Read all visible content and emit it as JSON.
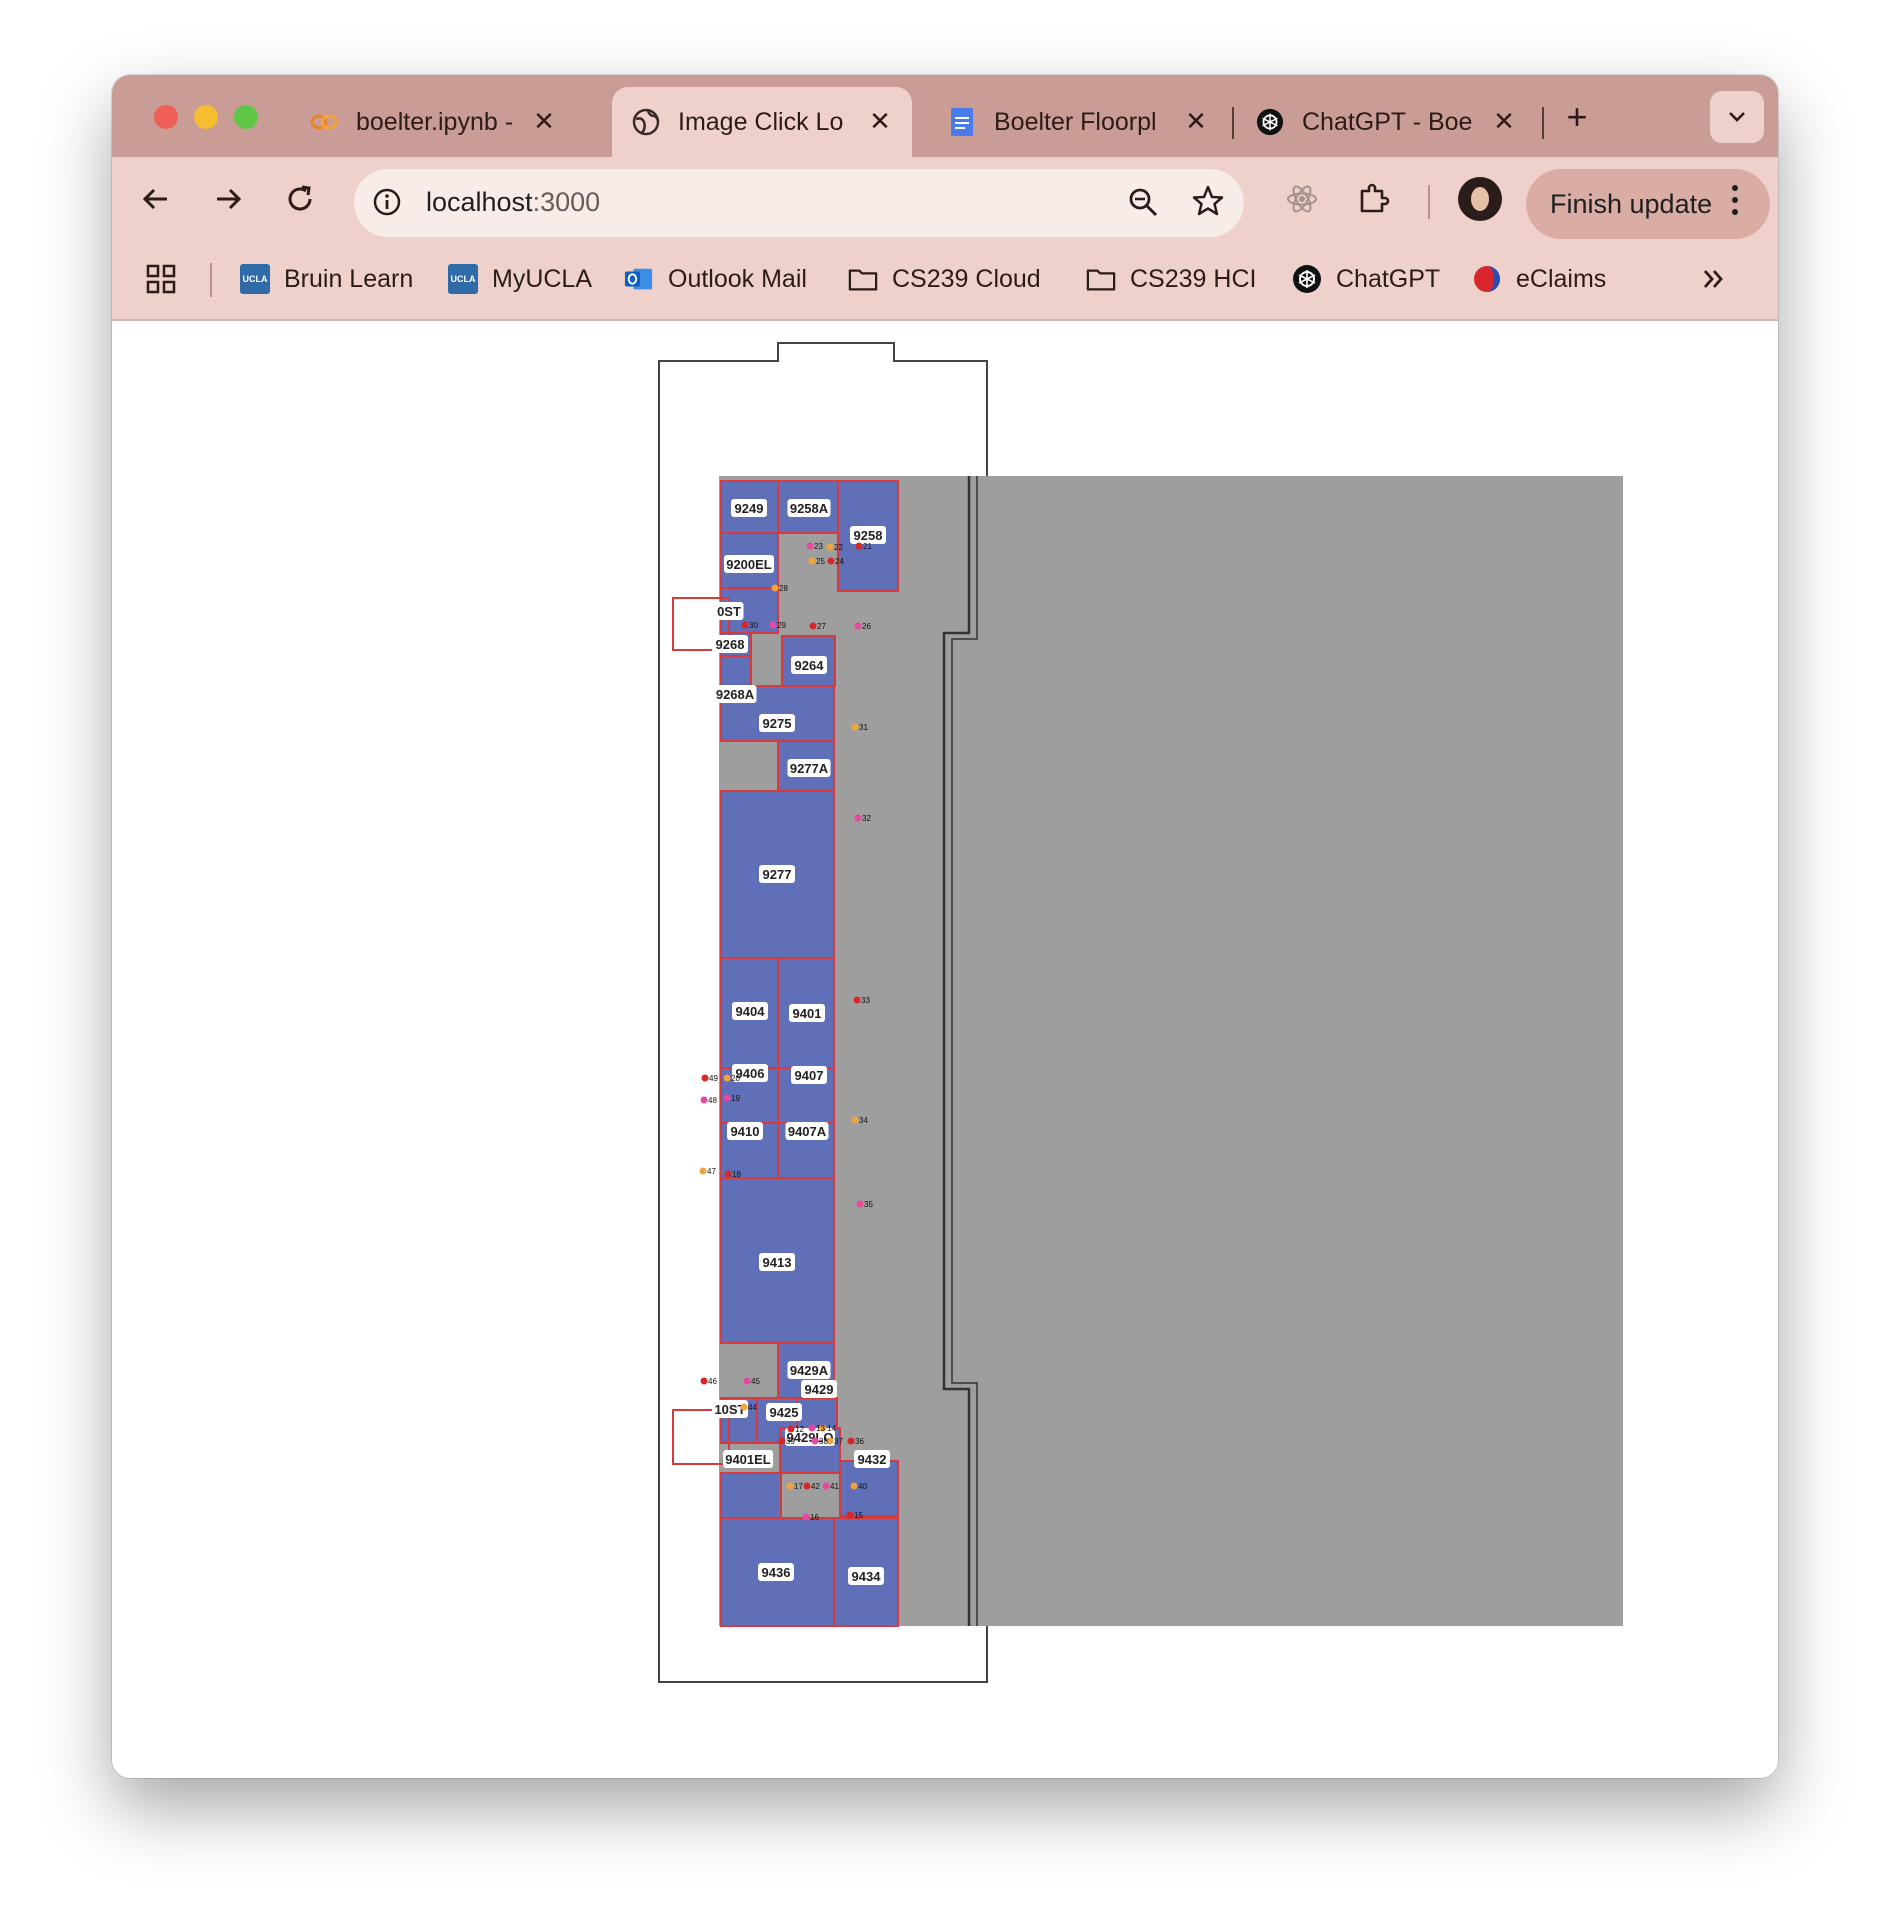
{
  "window": {
    "tabs": [
      {
        "title": "boelter.ipynb -",
        "icon": "jupyter-icon",
        "active": false
      },
      {
        "title": "Image Click Lo",
        "icon": "globe-icon",
        "active": true
      },
      {
        "title": "Boelter Floorpl",
        "icon": "google-docs-icon",
        "active": false
      },
      {
        "title": "ChatGPT - Boe",
        "icon": "chatgpt-icon",
        "active": false
      }
    ],
    "new_tab_symbol": "+"
  },
  "toolbar": {
    "url_host": "localhost",
    "url_port": ":3000",
    "finish_update_label": "Finish update"
  },
  "bookmarks": [
    {
      "label": "Bruin Learn",
      "icon": "ucla-icon"
    },
    {
      "label": "MyUCLA",
      "icon": "ucla-icon"
    },
    {
      "label": "Outlook Mail",
      "icon": "outlook-icon"
    },
    {
      "label": "CS239 Cloud",
      "icon": "folder-icon"
    },
    {
      "label": "CS239 HCI",
      "icon": "folder-icon"
    },
    {
      "label": "ChatGPT",
      "icon": "chatgpt-icon"
    },
    {
      "label": "eClaims",
      "icon": "eclaims-icon"
    }
  ],
  "ucla_badge": "UCLA",
  "floorplan": {
    "rooms": [
      "9249",
      "9258A",
      "9258",
      "9200EL",
      "0ST",
      "9268",
      "9268A",
      "9264",
      "9275",
      "9277A",
      "9277",
      "9404",
      "9401",
      "9406",
      "9407",
      "9410",
      "9407A",
      "9413",
      "9429A",
      "10ST",
      "9425",
      "9429",
      "9429LO",
      "9401EL",
      "9432",
      "9436",
      "9434"
    ],
    "click_labels": [
      "21",
      "22",
      "23",
      "24",
      "25",
      "26",
      "27",
      "28",
      "29",
      "30",
      "31",
      "32",
      "33",
      "34",
      "35",
      "36",
      "37",
      "38",
      "39",
      "40",
      "41",
      "42",
      "44",
      "45",
      "46",
      "47",
      "48",
      "49",
      "20",
      "19",
      "18",
      "17",
      "16",
      "15",
      "14",
      "13",
      "12"
    ]
  },
  "colors": {
    "tabstrip": "#c99d95",
    "toolbar": "#eed1cb",
    "room_fill": "#5f6fb8",
    "corridor": "#9e9e9e",
    "highlight": "#d63a3a"
  }
}
